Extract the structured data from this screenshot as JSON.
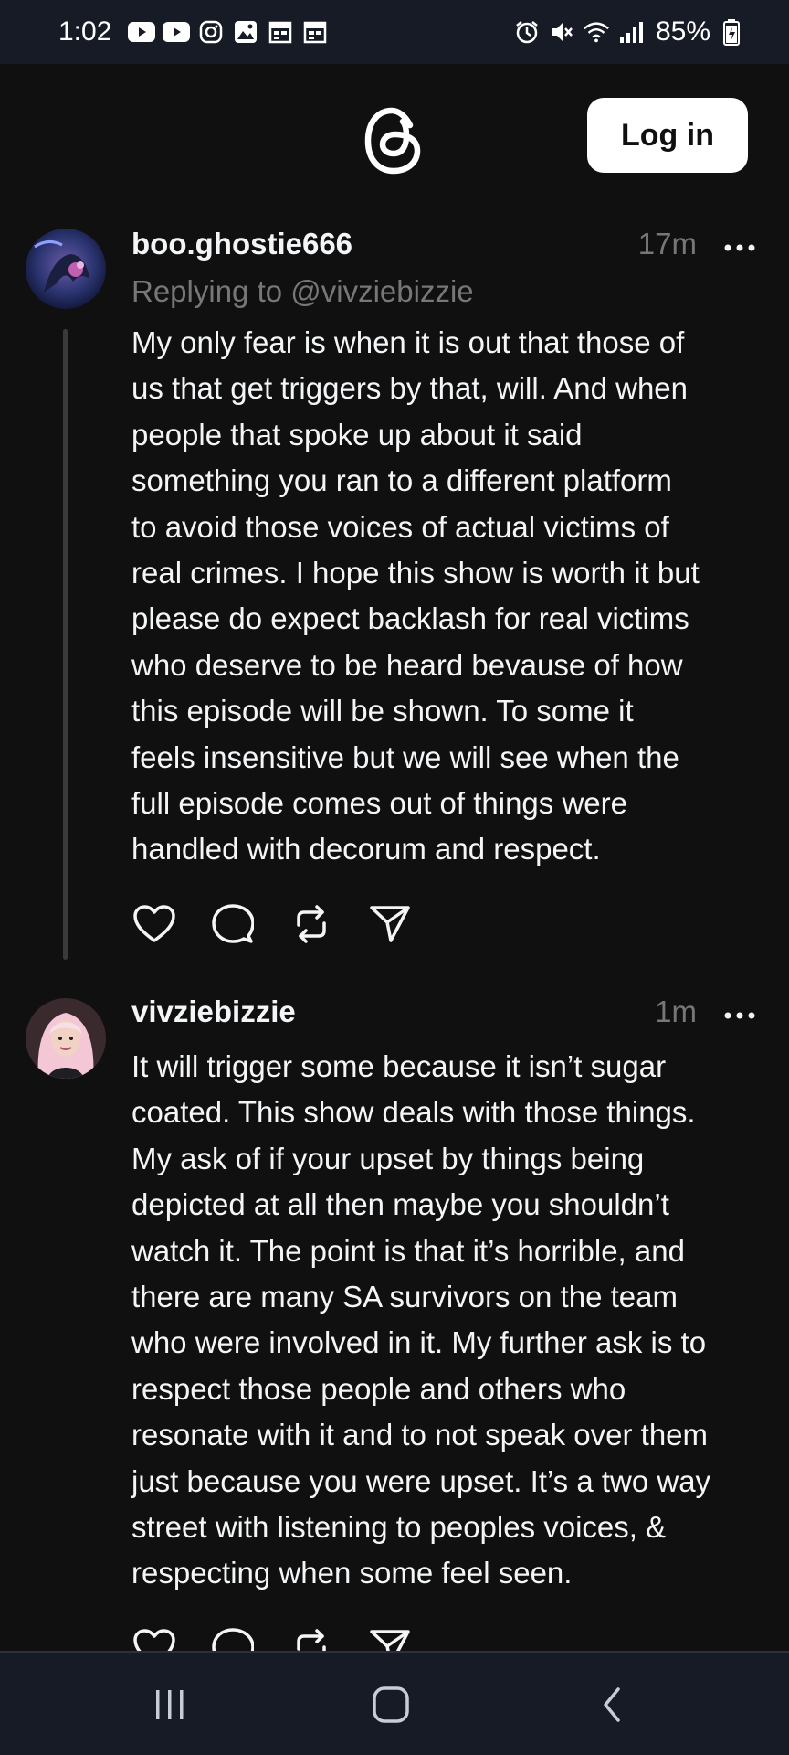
{
  "status_bar": {
    "time": "1:02",
    "battery": "85%",
    "left_icons": [
      "youtube-icon",
      "youtube-icon",
      "instagram-icon",
      "gallery-icon",
      "calendar-icon",
      "calendar-icon"
    ],
    "right_icons": [
      "alarm-icon",
      "mute-icon",
      "wifi-icon",
      "signal-icon",
      "battery-icon"
    ]
  },
  "header": {
    "logo": "threads-logo-icon",
    "login_label": "Log in"
  },
  "posts": [
    {
      "username": "boo.ghostie666",
      "time": "17m",
      "replying_to": "Replying to @vivziebizzie",
      "lines": [
        "My only fear is when it is out that those of",
        "us that get triggers by that, will. And when",
        "people that spoke up about it said",
        "something you ran to a different platform",
        "to avoid those voices of actual victims of",
        "real crimes. I hope this show is worth it but",
        "please do expect backlash for real victims",
        "who deserve to be heard bevause of how",
        "this episode will be shown. To some it",
        "feels insensitive but we will see when the",
        "full episode comes out of things were",
        "handled with decorum and respect."
      ]
    },
    {
      "username": "vivziebizzie",
      "time": "1m",
      "lines": [
        "It will trigger some because it isn’t sugar",
        "coated. This show deals with those things.",
        "My ask of if your upset by things being",
        "depicted at all then maybe you shouldn’t",
        "watch it. The point is that it’s horrible, and",
        "there are many SA survivors on the team",
        "who were involved in it. My further ask is to",
        "respect those people and others who",
        "resonate with it and to not speak over them",
        "just because you were upset. It’s a two way",
        "street with listening to peoples voices, &",
        "respecting when some feel seen."
      ]
    }
  ],
  "actions": [
    "like-icon",
    "comment-icon",
    "repost-icon",
    "share-icon"
  ],
  "nav_bar": [
    "recents-icon",
    "home-icon",
    "back-icon"
  ],
  "colors": {
    "background": "#101010",
    "system_bar": "#161b26",
    "text": "#f3f5f7",
    "secondary_text": "#777777",
    "thread_line": "#3a3a3a"
  }
}
